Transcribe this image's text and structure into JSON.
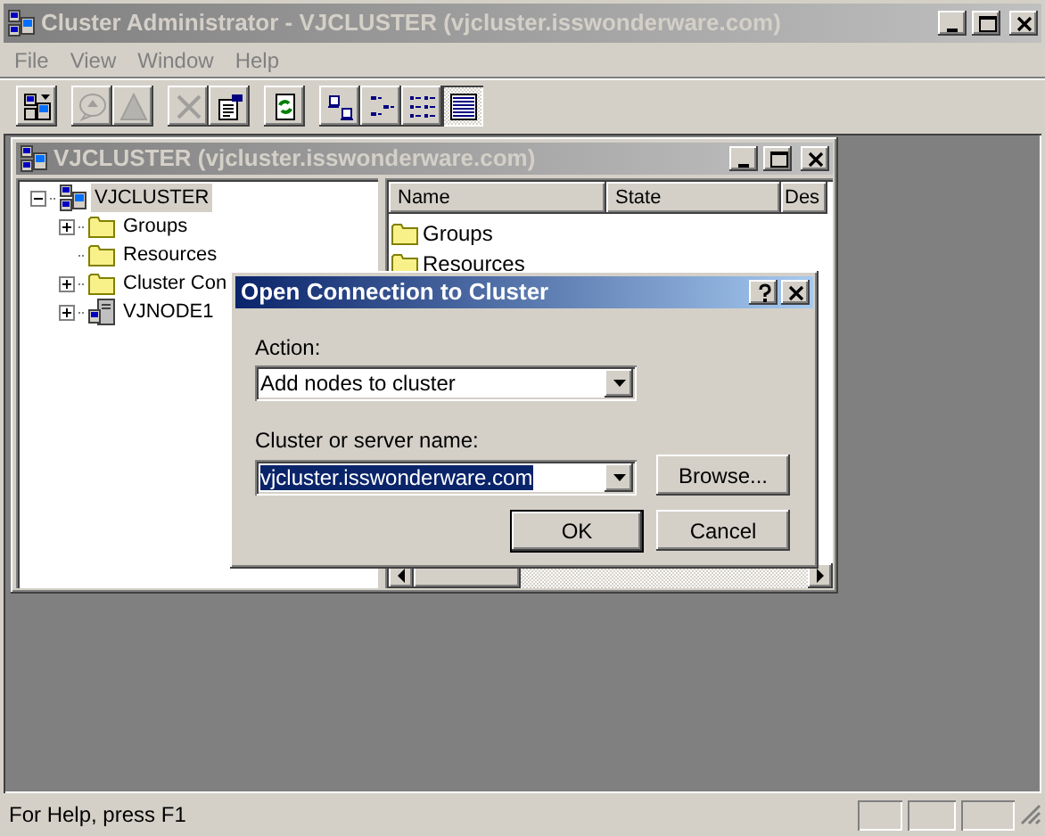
{
  "window": {
    "title": "Cluster Administrator - VJCLUSTER (vjcluster.isswonderware.com)"
  },
  "menu": [
    "File",
    "View",
    "Window",
    "Help"
  ],
  "toolbar": [
    [
      {
        "kind": "cluster",
        "disabled": false,
        "pressed": false
      }
    ],
    [
      {
        "kind": "balloon",
        "disabled": true,
        "pressed": false
      },
      {
        "kind": "triangle",
        "disabled": true,
        "pressed": false
      }
    ],
    [
      {
        "kind": "delete",
        "disabled": true,
        "pressed": false
      },
      {
        "kind": "properties",
        "disabled": false,
        "pressed": false
      }
    ],
    [
      {
        "kind": "refresh",
        "disabled": false,
        "pressed": false
      }
    ],
    [
      {
        "kind": "large-icons",
        "disabled": false,
        "pressed": false
      },
      {
        "kind": "small-icons",
        "disabled": false,
        "pressed": false
      },
      {
        "kind": "list",
        "disabled": false,
        "pressed": false
      },
      {
        "kind": "details",
        "disabled": false,
        "pressed": true
      }
    ]
  ],
  "child_window": {
    "title": "VJCLUSTER (vjcluster.isswonderware.com)",
    "tree": {
      "label": "VJCLUSTER",
      "kind": "cluster",
      "has_children": true,
      "expanded": true,
      "selected": true,
      "children": [
        {
          "label": "Groups",
          "kind": "folder",
          "has_children": true,
          "expanded": false,
          "selected": false
        },
        {
          "label": "Resources",
          "kind": "folder",
          "has_children": false,
          "selected": false
        },
        {
          "label": "Cluster Con",
          "kind": "folder",
          "has_children": true,
          "expanded": false,
          "selected": false
        },
        {
          "label": "VJNODE1",
          "kind": "node",
          "has_children": true,
          "expanded": false,
          "selected": false
        }
      ]
    },
    "list": {
      "columns": [
        "Name",
        "State",
        "Des"
      ],
      "rows": [
        {
          "name": "Groups"
        },
        {
          "name": "Resources"
        }
      ]
    }
  },
  "dialog": {
    "title": "Open Connection to Cluster",
    "action_label": "Action:",
    "action_value": "Add nodes to cluster",
    "server_label": "Cluster or server name:",
    "server_value": "vjcluster.isswonderware.com",
    "server_value_selected": true,
    "browse_button": "Browse...",
    "ok_button": "OK",
    "cancel_button": "Cancel"
  },
  "status_bar": {
    "text": "For Help, press F1"
  }
}
